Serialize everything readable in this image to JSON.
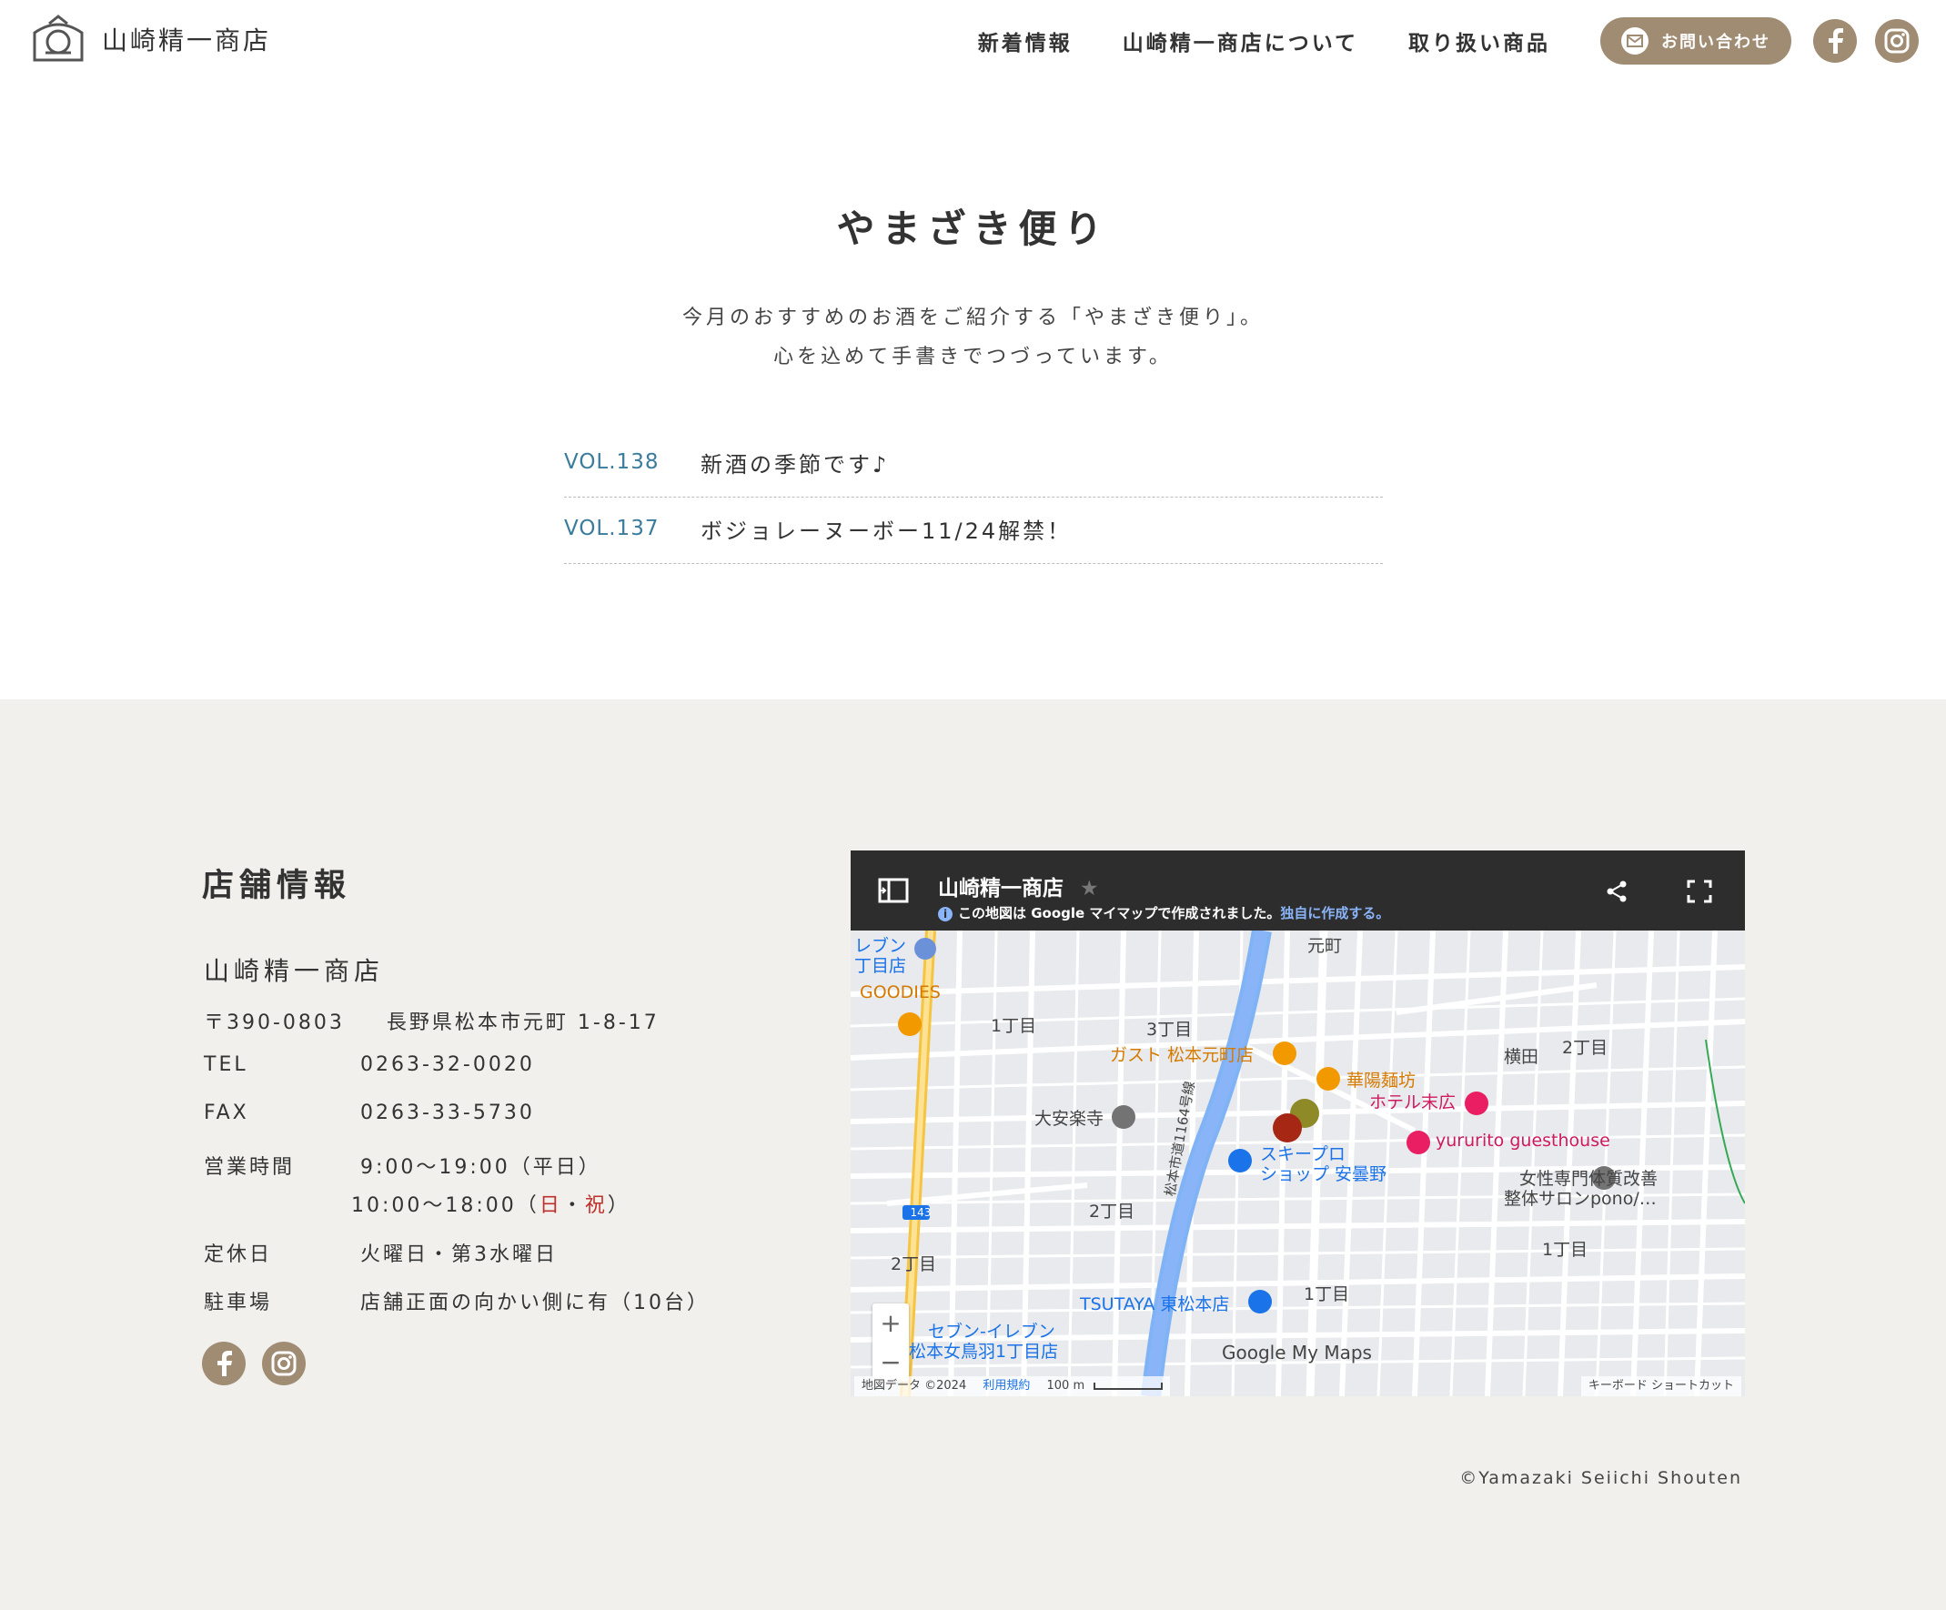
{
  "header": {
    "logo_text": "山崎精一商店",
    "nav": [
      "新着情報",
      "山崎精一商店について",
      "取り扱い商品"
    ],
    "contact_label": "お問い合わせ"
  },
  "letters": {
    "title": "やまざき便り",
    "lead_line1": "今月のおすすめのお酒をご紹介する「やまざき便り」。",
    "lead_line2": "心を込めて手書きでつづっています。",
    "items": [
      {
        "vol": "VOL.138",
        "title": "新酒の季節です♪"
      },
      {
        "vol": "VOL.137",
        "title": "ボジョレーヌーボー11/24解禁！"
      }
    ]
  },
  "shop": {
    "heading": "店舗情報",
    "name": "山崎精一商店",
    "postal": "〒390-0803",
    "address": "長野県松本市元町 1-8-17",
    "tel_label": "TEL",
    "tel": "0263-32-0020",
    "fax_label": "FAX",
    "fax": "0263-33-5730",
    "hours_label": "営業時間",
    "hours_weekday": "9:00〜19:00（平日）",
    "hours_holiday_time": "10:00〜18:00（",
    "hours_holiday_sun": "日",
    "hours_holiday_sep": "・",
    "hours_holiday_hol": "祝",
    "hours_holiday_close": "）",
    "closed_label": "定休日",
    "closed": "火曜日・第3水曜日",
    "parking_label": "駐車場",
    "parking": "店舗正面の向かい側に有（10台）"
  },
  "map": {
    "title": "山崎精一商店",
    "sub_text": "この地図は Google マイマップで作成されました。",
    "sub_link": "独自に作成する。",
    "labels": {
      "l1": "レブン",
      "l2": "丁目店",
      "l3": "GOODIES",
      "l4": "1丁目",
      "l5": "3丁目",
      "l6": "元町",
      "l7": "ガスト 松本元町店",
      "l8": "華陽麺坊",
      "l9": "横田",
      "l10": "2丁目",
      "l11": "ホテル末広",
      "l12": "大安楽寺",
      "l13": "yururito guesthouse",
      "l14": "スキープロ",
      "l15": "ショップ 安曇野",
      "l16": "女性専門体質改善",
      "l17": "整体サロンpono/…",
      "l18": "2丁目",
      "l19": "松本市道1164号線",
      "l20": "2丁目",
      "l21": "1丁目",
      "l22": "TSUTAYA 東松本店",
      "l23": "1丁目",
      "l24": "セブン-イレブン",
      "l25": "松本女鳥羽1丁目店",
      "l26": "143",
      "l27": "Google My Maps"
    },
    "footer_data": "地図データ ©2024",
    "footer_terms": "利用規約",
    "footer_scale": "100 m",
    "footer_shortcuts": "キーボード ショートカット",
    "zoom_in": "+",
    "zoom_out": "−"
  },
  "copyright": "©Yamazaki Seiichi Shouten",
  "colors": {
    "accent": "#a08b73",
    "link_vol": "#3b7c9c",
    "footer_bg": "#f1f0ed",
    "holiday_red": "#c0302a"
  }
}
